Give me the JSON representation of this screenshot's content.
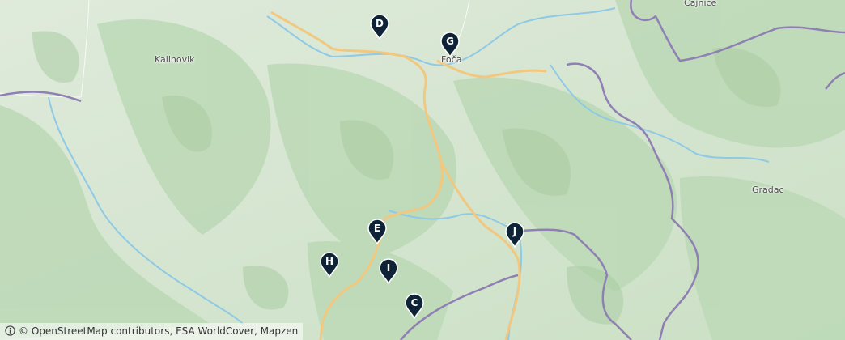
{
  "map": {
    "places": [
      {
        "id": "kalinovik",
        "label": "Kalinovik"
      },
      {
        "id": "foca",
        "label": "Foča"
      },
      {
        "id": "cajnice",
        "label": "Čajniče"
      },
      {
        "id": "gradac",
        "label": "Gradac"
      }
    ],
    "markers": [
      {
        "id": "d",
        "label": "D"
      },
      {
        "id": "g",
        "label": "G"
      },
      {
        "id": "e",
        "label": "E"
      },
      {
        "id": "j",
        "label": "J"
      },
      {
        "id": "h",
        "label": "H"
      },
      {
        "id": "i",
        "label": "I"
      },
      {
        "id": "c",
        "label": "C"
      }
    ],
    "attribution": "© OpenStreetMap contributors, ESA WorldCover, Mapzen",
    "colors": {
      "land": "#d6e6cf",
      "forest": "#bcd9b6",
      "river": "#8ec9e6",
      "road": "#f2c77e",
      "border": "#8f7fb4",
      "marker": "#0f2336"
    }
  }
}
